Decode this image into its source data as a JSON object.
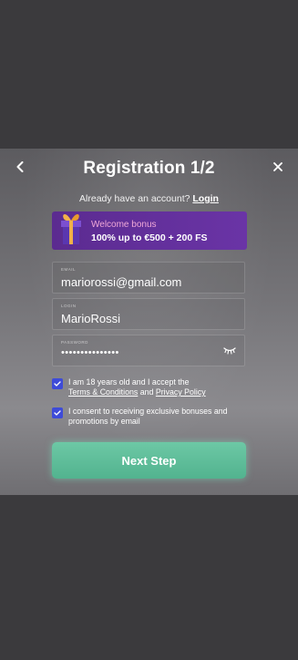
{
  "header": {
    "title": "Registration 1/2"
  },
  "login_prompt": {
    "text": "Already have an account?",
    "link": "Login"
  },
  "bonus": {
    "line1": "Welcome bonus",
    "line2": "100% up to €500 + 200 FS"
  },
  "fields": {
    "email": {
      "label": "EMAIL",
      "value": "mariorossi@gmail.com"
    },
    "login": {
      "label": "LOGIN",
      "value": "MarioRossi"
    },
    "password": {
      "label": "PASSWORD",
      "value": "•••••••••••••••"
    }
  },
  "consents": {
    "terms": {
      "prefix": "I am 18 years old and I accept the",
      "link1": "Terms & Conditions",
      "joiner": "and",
      "link2": "Privacy Policy"
    },
    "promo": {
      "text": "I consent to receiving exclusive bonuses and promotions by email"
    }
  },
  "actions": {
    "next_label": "Next Step"
  },
  "colors": {
    "accent_button": "#5cbd98",
    "checkbox": "#3e4bd8",
    "bonus_bg": "#6430a0"
  },
  "icons": {
    "back": "chevron-left-icon",
    "close": "close-icon",
    "gift": "gift-icon",
    "eye": "eye-closed-icon",
    "check": "check-icon"
  }
}
